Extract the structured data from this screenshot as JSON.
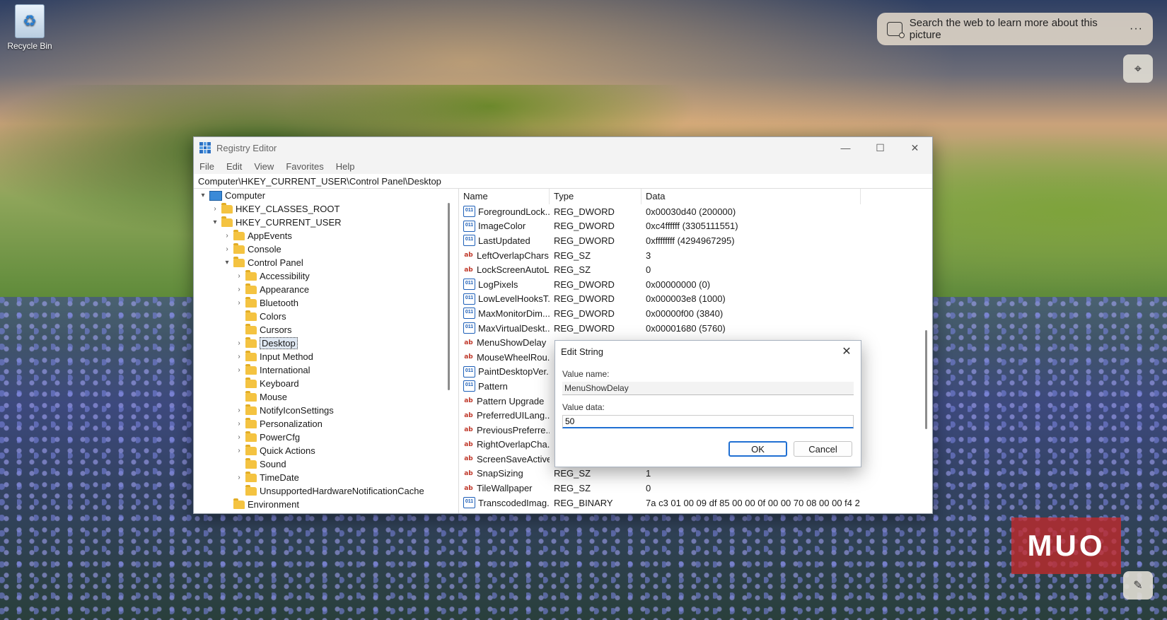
{
  "desktop": {
    "recycle_bin_label": "Recycle Bin",
    "search_pill_text": "Search the web to learn more about this picture",
    "search_more": "···",
    "watermark": "MUO"
  },
  "window": {
    "title": "Registry Editor",
    "minimize": "—",
    "maximize": "☐",
    "close": "✕",
    "menu": [
      "File",
      "Edit",
      "View",
      "Favorites",
      "Help"
    ],
    "address": "Computer\\HKEY_CURRENT_USER\\Control Panel\\Desktop"
  },
  "tree": [
    {
      "label": "Computer",
      "caret": "▾",
      "indent": 0,
      "icon": "pc"
    },
    {
      "label": "HKEY_CLASSES_ROOT",
      "caret": "›",
      "indent": 1
    },
    {
      "label": "HKEY_CURRENT_USER",
      "caret": "▾",
      "indent": 1
    },
    {
      "label": "AppEvents",
      "caret": "›",
      "indent": 2
    },
    {
      "label": "Console",
      "caret": "›",
      "indent": 2
    },
    {
      "label": "Control Panel",
      "caret": "▾",
      "indent": 2
    },
    {
      "label": "Accessibility",
      "caret": "›",
      "indent": 3
    },
    {
      "label": "Appearance",
      "caret": "›",
      "indent": 3
    },
    {
      "label": "Bluetooth",
      "caret": "›",
      "indent": 3
    },
    {
      "label": "Colors",
      "caret": "",
      "indent": 3
    },
    {
      "label": "Cursors",
      "caret": "",
      "indent": 3
    },
    {
      "label": "Desktop",
      "caret": "›",
      "indent": 3,
      "selected": true
    },
    {
      "label": "Input Method",
      "caret": "›",
      "indent": 3
    },
    {
      "label": "International",
      "caret": "›",
      "indent": 3
    },
    {
      "label": "Keyboard",
      "caret": "",
      "indent": 3
    },
    {
      "label": "Mouse",
      "caret": "",
      "indent": 3
    },
    {
      "label": "NotifyIconSettings",
      "caret": "›",
      "indent": 3
    },
    {
      "label": "Personalization",
      "caret": "›",
      "indent": 3
    },
    {
      "label": "PowerCfg",
      "caret": "›",
      "indent": 3
    },
    {
      "label": "Quick Actions",
      "caret": "›",
      "indent": 3
    },
    {
      "label": "Sound",
      "caret": "",
      "indent": 3
    },
    {
      "label": "TimeDate",
      "caret": "›",
      "indent": 3
    },
    {
      "label": "UnsupportedHardwareNotificationCache",
      "caret": "",
      "indent": 3
    },
    {
      "label": "Environment",
      "caret": "",
      "indent": 2
    }
  ],
  "list": {
    "headers": [
      "Name",
      "Type",
      "Data"
    ],
    "rows": [
      {
        "name": "ForegroundLock...",
        "type": "REG_DWORD",
        "data": "0x00030d40 (200000)",
        "kind": "dw"
      },
      {
        "name": "ImageColor",
        "type": "REG_DWORD",
        "data": "0xc4ffffff (3305111551)",
        "kind": "dw"
      },
      {
        "name": "LastUpdated",
        "type": "REG_DWORD",
        "data": "0xffffffff (4294967295)",
        "kind": "dw"
      },
      {
        "name": "LeftOverlapChars",
        "type": "REG_SZ",
        "data": "3",
        "kind": "sz"
      },
      {
        "name": "LockScreenAutoL...",
        "type": "REG_SZ",
        "data": "0",
        "kind": "sz"
      },
      {
        "name": "LogPixels",
        "type": "REG_DWORD",
        "data": "0x00000000 (0)",
        "kind": "dw"
      },
      {
        "name": "LowLevelHooksT...",
        "type": "REG_DWORD",
        "data": "0x000003e8 (1000)",
        "kind": "dw"
      },
      {
        "name": "MaxMonitorDim...",
        "type": "REG_DWORD",
        "data": "0x00000f00 (3840)",
        "kind": "dw"
      },
      {
        "name": "MaxVirtualDeskt...",
        "type": "REG_DWORD",
        "data": "0x00001680 (5760)",
        "kind": "dw"
      },
      {
        "name": "MenuShowDelay",
        "type": "",
        "data": "",
        "kind": "sz"
      },
      {
        "name": "MouseWheelRou...",
        "type": "",
        "data": "",
        "kind": "sz"
      },
      {
        "name": "PaintDesktopVer...",
        "type": "",
        "data": "",
        "kind": "dw"
      },
      {
        "name": "Pattern",
        "type": "",
        "data": "",
        "kind": "dw"
      },
      {
        "name": "Pattern Upgrade",
        "type": "",
        "data": "",
        "kind": "sz"
      },
      {
        "name": "PreferredUILang...",
        "type": "",
        "data": "",
        "kind": "sz"
      },
      {
        "name": "PreviousPreferre...",
        "type": "",
        "data": "",
        "kind": "sz"
      },
      {
        "name": "RightOverlapCha...",
        "type": "",
        "data": "",
        "kind": "sz"
      },
      {
        "name": "ScreenSaveActive",
        "type": "",
        "data": "",
        "kind": "sz"
      },
      {
        "name": "SnapSizing",
        "type": "REG_SZ",
        "data": "1",
        "kind": "sz"
      },
      {
        "name": "TileWallpaper",
        "type": "REG_SZ",
        "data": "0",
        "kind": "sz"
      },
      {
        "name": "TranscodedImag...",
        "type": "REG_BINARY",
        "data": "7a c3 01 00 09 df 85 00 00 0f 00 00 70 08 00 00 f4 2...",
        "kind": "dw"
      }
    ]
  },
  "dialog": {
    "title": "Edit String",
    "close": "✕",
    "value_name_label": "Value name:",
    "value_name": "MenuShowDelay",
    "value_data_label": "Value data:",
    "value_data": "50",
    "ok": "OK",
    "cancel": "Cancel"
  }
}
